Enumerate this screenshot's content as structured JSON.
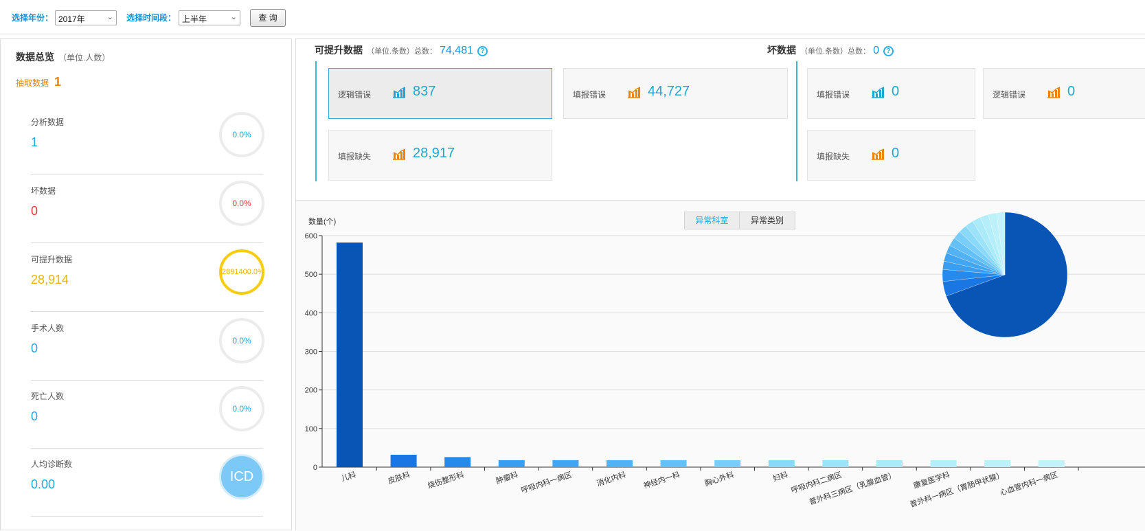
{
  "filters": {
    "year_label": "选择年份：",
    "year_value": "2017年",
    "period_label": "选择时间段：",
    "period_value": "上半年",
    "query_button": "查 询"
  },
  "overview": {
    "title": "数据总览",
    "unit": "（单位.人数）",
    "extract_label": "抽取数据",
    "extract_value": "1",
    "stats": [
      {
        "label": "分析数据",
        "value": "1",
        "percent": "0.0%",
        "color": "#1ea8e0"
      },
      {
        "label": "坏数据",
        "value": "0",
        "percent": "0.0%",
        "color": "#e63535"
      },
      {
        "label": "可提升数据",
        "value": "28,914",
        "percent": "2891400.0%",
        "color": "#e7b800"
      },
      {
        "label": "手术人数",
        "value": "0",
        "percent": "0.0%",
        "color": "#1ea8e0"
      },
      {
        "label": "死亡人数",
        "value": "0",
        "percent": "0.0%",
        "color": "#1ea8e0"
      },
      {
        "label": "人均诊断数",
        "value": "0.00",
        "percent": "ICD",
        "color": "#1ea8e0"
      }
    ]
  },
  "improvable": {
    "title": "可提升数据",
    "unit": "（单位.条数）总数：",
    "total": "74,481",
    "cards": [
      {
        "label": "逻辑错误",
        "value": "837",
        "icon": "bar-chart-icon"
      },
      {
        "label": "填报错误",
        "value": "44,727",
        "icon": "bar-chart-icon"
      },
      {
        "label": "填报缺失",
        "value": "28,917",
        "icon": "bar-chart-icon"
      }
    ]
  },
  "bad": {
    "title": "坏数据",
    "unit": "（单位.条数）总数：",
    "total": "0",
    "cards": [
      {
        "label": "填报错误",
        "value": "0",
        "icon": "bar-chart-icon"
      },
      {
        "label": "逻辑错误",
        "value": "0",
        "icon": "bar-chart-icon"
      },
      {
        "label": "填报缺失",
        "value": "0",
        "icon": "bar-chart-icon"
      }
    ]
  },
  "chart_tabs": [
    "异常科室",
    "异常类别"
  ],
  "chart_data": [
    {
      "type": "bar",
      "ylabel": "数量(个)",
      "ylim": [
        0,
        600
      ],
      "yticks": [
        0,
        100,
        200,
        300,
        400,
        500,
        600
      ],
      "grid": true,
      "categories": [
        "儿科",
        "皮肤科",
        "烧伤整形科",
        "肿瘤科",
        "呼吸内科一病区",
        "消化内科",
        "神经内一科",
        "胸心外科",
        "妇科",
        "呼吸内科二病区",
        "普外科三病区（乳腺血管）",
        "康复医学科",
        "普外科一病区（胃肠甲状腺）",
        "心血管内科一病区"
      ],
      "values": [
        582,
        32,
        26,
        18,
        18,
        18,
        18,
        18,
        18,
        18,
        18,
        18,
        18,
        18
      ],
      "colors": [
        "#0855b5",
        "#1976e2",
        "#2689ec",
        "#3a9ef0",
        "#42a5f2",
        "#52b2f4",
        "#64c0f6",
        "#78cef8",
        "#8ad9f8",
        "#9ce3f9",
        "#aaeaf9",
        "#b4eefa",
        "#bcf1fa",
        "#c3f3fa"
      ]
    },
    {
      "type": "pie",
      "values": [
        582,
        32,
        26,
        18,
        18,
        18,
        18,
        18,
        18,
        18,
        18,
        18,
        18,
        18
      ]
    }
  ]
}
